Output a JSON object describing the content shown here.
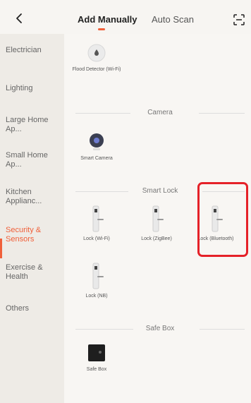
{
  "header": {
    "back_icon": "chevron-left-icon",
    "tabs": [
      "Add Manually",
      "Auto Scan"
    ],
    "active_tab": "Add Manually",
    "scan_icon": "scan-icon",
    "accent": "#f0603a"
  },
  "sidebar": {
    "items": [
      {
        "label": "Electrician"
      },
      {
        "label": "Lighting"
      },
      {
        "label": "Large Home Ap..."
      },
      {
        "label": "Small Home Ap..."
      },
      {
        "label": "Kitchen Applianc..."
      },
      {
        "label": "Security & Sensors"
      },
      {
        "label": "Exercise & Health"
      },
      {
        "label": "Others"
      }
    ],
    "active": "Security & Sensors"
  },
  "content": {
    "devices_top": [
      {
        "label": "Flood Detector (Wi-Fi)",
        "icon": "flood-detector-icon"
      }
    ],
    "sections": [
      {
        "title": "Camera",
        "devices": [
          {
            "label": "Smart Camera",
            "icon": "camera-icon"
          }
        ]
      },
      {
        "title": "Smart Lock",
        "devices": [
          {
            "label": "Lock (Wi-Fi)",
            "icon": "lock-icon"
          },
          {
            "label": "Lock (ZigBee)",
            "icon": "lock-icon"
          },
          {
            "label": "Lock (Bluetooth)",
            "icon": "lock-icon"
          },
          {
            "label": "Lock (NB)",
            "icon": "lock-icon"
          }
        ]
      },
      {
        "title": "Safe Box",
        "devices": [
          {
            "label": "Safe Box",
            "icon": "safe-box-icon"
          }
        ]
      }
    ]
  }
}
